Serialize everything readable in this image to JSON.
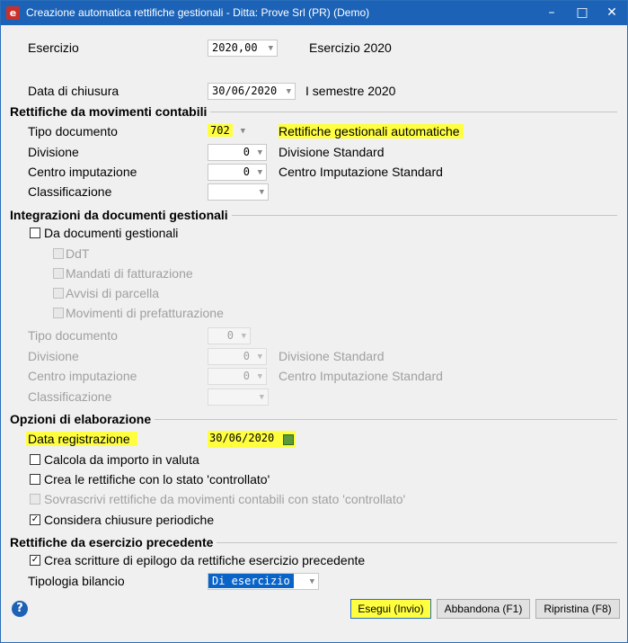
{
  "window": {
    "title": "Creazione automatica rettifiche gestionali - Ditta: Prove Srl (PR) (Demo)",
    "minimize": "–",
    "maximize": "□",
    "close": "✕"
  },
  "esercizio": {
    "label": "Esercizio",
    "value": "2020,00",
    "desc": "Esercizio 2020"
  },
  "chiusura": {
    "label": "Data di chiusura",
    "value": "30/06/2020",
    "desc": "I semestre 2020"
  },
  "sec_movimenti": {
    "title": "Rettifiche da movimenti contabili",
    "tipo_doc": {
      "label": "Tipo documento",
      "value": "702",
      "desc": "Rettifiche gestionali automatiche"
    },
    "divisione": {
      "label": "Divisione",
      "value": "0",
      "desc": "Divisione Standard"
    },
    "centro": {
      "label": "Centro imputazione",
      "value": "0",
      "desc": "Centro Imputazione Standard"
    },
    "classificazione": {
      "label": "Classificazione",
      "value": ""
    }
  },
  "sec_integrazioni": {
    "title": "Integrazioni da documenti gestionali",
    "da_documenti": "Da documenti gestionali",
    "ddt": "DdT",
    "mandati": "Mandati di fatturazione",
    "avvisi": "Avvisi di parcella",
    "prefatt": "Movimenti di prefatturazione",
    "tipo_doc": {
      "label": "Tipo documento",
      "value": "0"
    },
    "divisione": {
      "label": "Divisione",
      "value": "0",
      "desc": "Divisione Standard"
    },
    "centro": {
      "label": "Centro imputazione",
      "value": "0",
      "desc": "Centro Imputazione Standard"
    },
    "classificazione": {
      "label": "Classificazione",
      "value": ""
    }
  },
  "sec_opzioni": {
    "title": "Opzioni di elaborazione",
    "data_reg": {
      "label": "Data registrazione",
      "value": "30/06/2020"
    },
    "calcola": "Calcola da importo in valuta",
    "crea_controllato": "Crea le rettifiche con lo stato 'controllato'",
    "sovrascrivi": "Sovrascrivi rettifiche da movimenti contabili con stato 'controllato'",
    "considera": "Considera chiusure periodiche"
  },
  "sec_precedente": {
    "title": "Rettifiche da esercizio precedente",
    "crea_epilogo": "Crea scritture di epilogo da rettifiche esercizio precedente",
    "tipologia": {
      "label": "Tipologia bilancio",
      "value": "Di esercizio"
    }
  },
  "buttons": {
    "help": "?",
    "esegui": "Esegui (Invio)",
    "abbandona": "Abbandona (F1)",
    "ripristina": "Ripristina (F8)"
  },
  "checks": {
    "checked": "✓"
  }
}
